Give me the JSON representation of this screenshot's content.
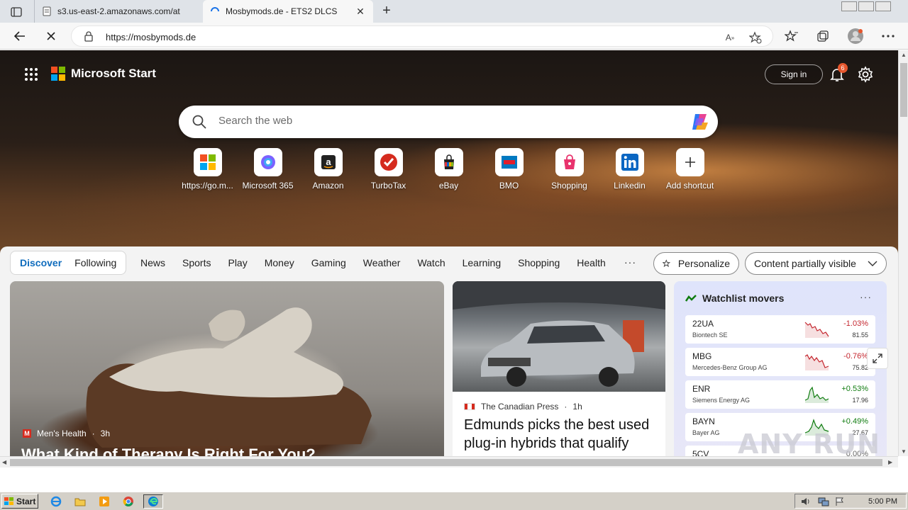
{
  "browser": {
    "tabs": [
      {
        "title": "s3.us-east-2.amazonaws.com/at",
        "active": false
      },
      {
        "title": "Mosbymods.de - ETS2 DLCS",
        "active": true
      }
    ],
    "url": "https://mosbymods.de"
  },
  "header": {
    "brand": "Microsoft Start",
    "sign_in": "Sign in",
    "notification_count": "6"
  },
  "search": {
    "placeholder": "Search the web"
  },
  "shortcuts": [
    {
      "label": "https://go.m...",
      "icon": "windows-icon"
    },
    {
      "label": "Microsoft 365",
      "icon": "microsoft-365-icon"
    },
    {
      "label": "Amazon",
      "icon": "amazon-icon"
    },
    {
      "label": "TurboTax",
      "icon": "turbotax-icon"
    },
    {
      "label": "eBay",
      "icon": "ebay-icon"
    },
    {
      "label": "BMO",
      "icon": "bmo-icon"
    },
    {
      "label": "Shopping",
      "icon": "shopping-icon"
    },
    {
      "label": "Linkedin",
      "icon": "linkedin-icon"
    },
    {
      "label": "Add shortcut",
      "icon": "plus-icon"
    }
  ],
  "feed_nav": {
    "pills": [
      "Discover",
      "Following"
    ],
    "links": [
      "News",
      "Sports",
      "Play",
      "Money",
      "Gaming",
      "Weather",
      "Watch",
      "Learning",
      "Shopping",
      "Health"
    ],
    "more": "···",
    "personalize": "Personalize",
    "content_visibility": "Content partially visible"
  },
  "cards": {
    "main": {
      "source": "Men's Health",
      "age": "3h",
      "headline": "What Kind of Therapy Is Right For You?"
    },
    "news": {
      "source": "The Canadian Press",
      "age": "1h",
      "headline": "Edmunds picks the best used plug-in hybrids that qualify"
    }
  },
  "watchlist": {
    "title": "Watchlist movers",
    "more": "···",
    "stocks": [
      {
        "symbol": "22UA",
        "name": "Biontech SE",
        "change": "-1.03%",
        "price": "81.55",
        "trend": "down"
      },
      {
        "symbol": "MBG",
        "name": "Mercedes-Benz Group AG",
        "change": "-0.76%",
        "price": "75.82",
        "trend": "down"
      },
      {
        "symbol": "ENR",
        "name": "Siemens Energy AG",
        "change": "+0.53%",
        "price": "17.96",
        "trend": "up"
      },
      {
        "symbol": "BAYN",
        "name": "Bayer AG",
        "change": "+0.49%",
        "price": "27.67",
        "trend": "up"
      },
      {
        "symbol": "5CV",
        "name": "",
        "change": "0.00%",
        "price": "",
        "trend": "flat"
      }
    ]
  },
  "taskbar": {
    "start": "Start",
    "clock": "5:00 PM"
  },
  "watermark": "ANY RUN",
  "colors": {
    "accent": "#0f6cbd",
    "negative": "#c4262e",
    "positive": "#107c10",
    "badge": "#e5562d"
  }
}
